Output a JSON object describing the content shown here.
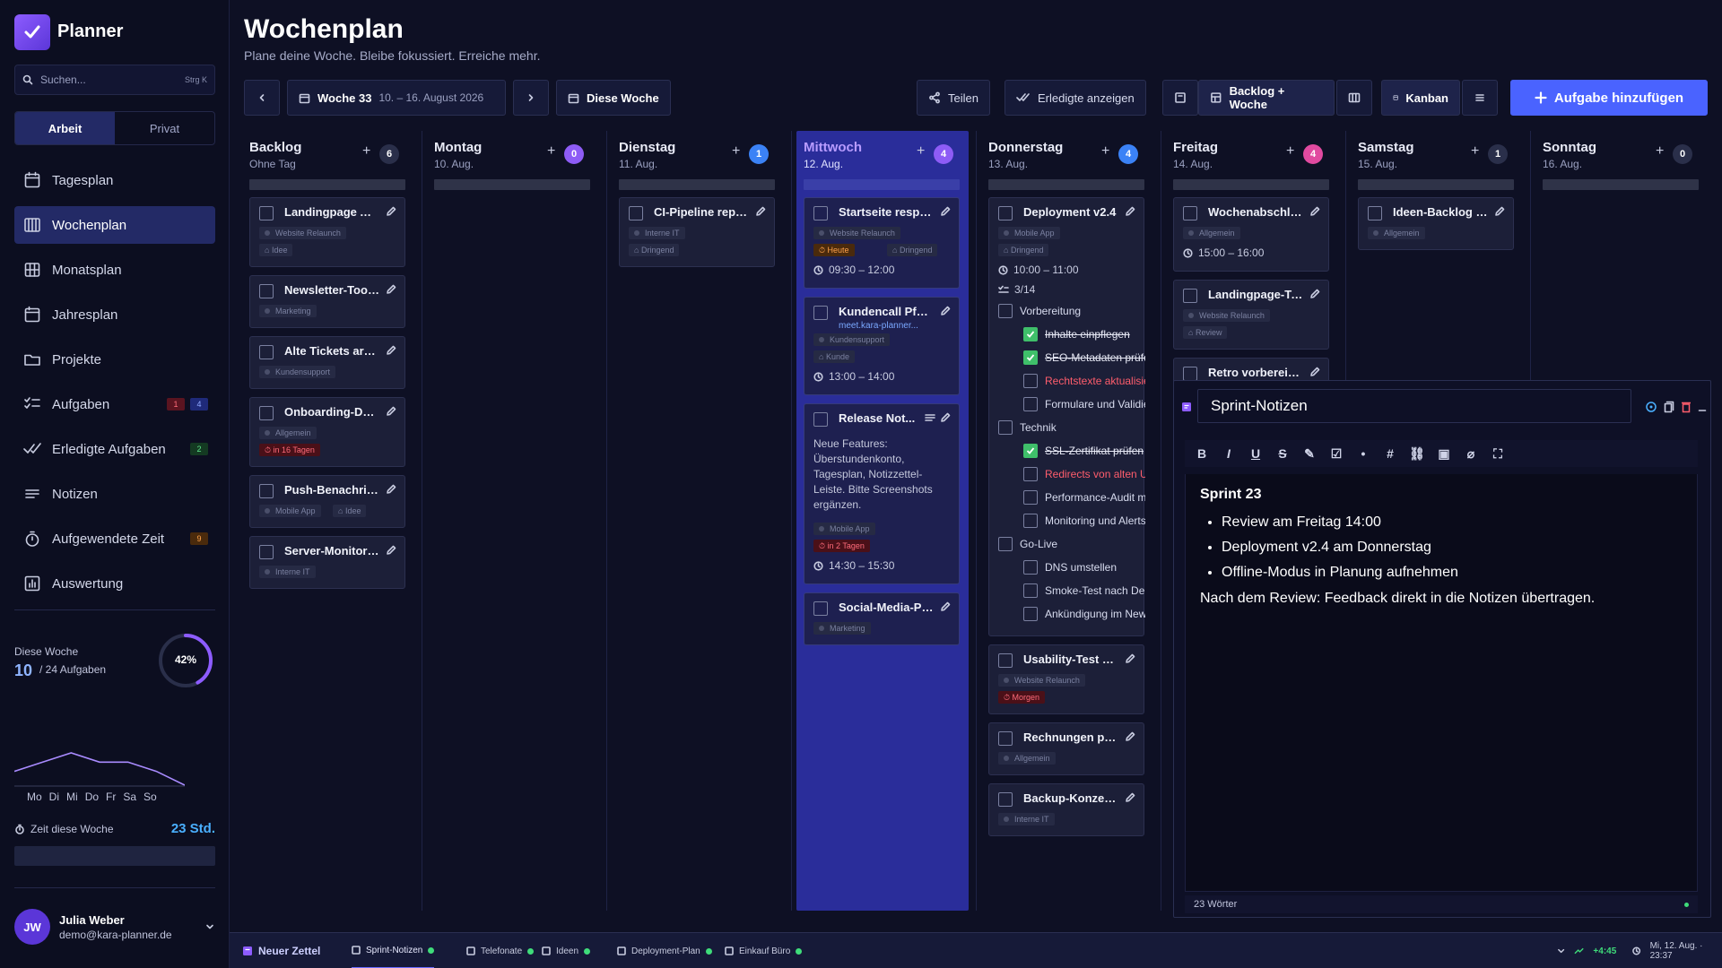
{
  "app": {
    "name": "Planner"
  },
  "search": {
    "placeholder": "Suchen...",
    "shortcut": "Strg K"
  },
  "modes": [
    "Arbeit",
    "Privat"
  ],
  "nav": [
    {
      "label": "Tagesplan",
      "icon": "calendar-day-icon"
    },
    {
      "label": "Wochenplan",
      "icon": "calendar-week-icon",
      "active": true
    },
    {
      "label": "Monatsplan",
      "icon": "calendar-grid-icon"
    },
    {
      "label": "Jahresplan",
      "icon": "calendar-year-icon"
    },
    {
      "label": "Projekte",
      "icon": "folder-icon"
    },
    {
      "label": "Aufgaben",
      "icon": "checklist-icon",
      "badges": [
        {
          "text": "1",
          "color": "red"
        },
        {
          "text": "4",
          "color": "blue"
        }
      ]
    },
    {
      "label": "Erledigte Aufgaben",
      "icon": "double-check-icon",
      "badges": [
        {
          "text": "2",
          "color": "green"
        }
      ]
    },
    {
      "label": "Notizen",
      "icon": "notes-icon"
    },
    {
      "label": "Aufgewendete Zeit",
      "icon": "stopwatch-icon",
      "badges": [
        {
          "text": "9",
          "color": "orange"
        }
      ]
    },
    {
      "label": "Auswertung",
      "icon": "chart-icon"
    }
  ],
  "week_stats": {
    "label": "Diese Woche",
    "done": "10",
    "total": "/ 24 Aufgaben",
    "percent_text": "42%",
    "progress": 0.42,
    "days": [
      "Mo",
      "Di",
      "Mi",
      "Do",
      "Fr",
      "Sa",
      "So"
    ],
    "spark": [
      3,
      5,
      7,
      5,
      5,
      3,
      0
    ],
    "time_label": "Zeit diese Woche",
    "time_value": "23 Std."
  },
  "user": {
    "initials": "JW",
    "name": "Julia Weber",
    "email": "demo@kara-planner.de"
  },
  "header": {
    "title": "Wochenplan",
    "subtitle": "Plane deine Woche. Bleibe fokussiert. Erreiche mehr."
  },
  "toolbar": {
    "week": "Woche 33",
    "range": "10. – 16. August 2026",
    "this_week": "Diese Woche",
    "share": "Teilen",
    "show_done": "Erledigte anzeigen",
    "backlog_week": "Backlog + Woche",
    "kanban": "Kanban",
    "add_task": "Aufgabe hinzufügen"
  },
  "columns": [
    {
      "name": "Backlog",
      "date": "Ohne Tag",
      "count": "6",
      "count_color": "#2a2f4a"
    },
    {
      "name": "Montag",
      "date": "10. Aug.",
      "count": "0",
      "count_color": "#8e5cf6"
    },
    {
      "name": "Dienstag",
      "date": "11. Aug.",
      "count": "1",
      "count_color": "#3b82f6"
    },
    {
      "name": "Mittwoch",
      "date": "12. Aug.",
      "count": "4",
      "count_color": "#8e5cf6"
    },
    {
      "name": "Donnerstag",
      "date": "13. Aug.",
      "count": "4",
      "count_color": "#3b82f6"
    },
    {
      "name": "Freitag",
      "date": "14. Aug.",
      "count": "4",
      "count_color": "#e14aa0"
    },
    {
      "name": "Samstag",
      "date": "15. Aug.",
      "count": "1",
      "count_color": "#2a2f4a"
    },
    {
      "name": "Sonntag",
      "date": "16. Aug.",
      "count": "0",
      "count_color": "#2a2f4a"
    }
  ],
  "cards": {
    "backlog": [
      {
        "title": "Landingpage A/...",
        "tags": [
          "Website Relaunch"
        ],
        "labels": [
          "Idee"
        ]
      },
      {
        "title": "Newsletter-Tool ...",
        "tags": [
          "Marketing"
        ]
      },
      {
        "title": "Alte Tickets arc...",
        "tags": [
          "Kundensupport"
        ]
      },
      {
        "title": "Onboarding-Dok...",
        "tags": [
          "Allgemein"
        ],
        "due": "in 16 Tagen"
      },
      {
        "title": "Push-Benachric...",
        "tags": [
          "Mobile App"
        ],
        "labels": [
          "Idee"
        ]
      },
      {
        "title": "Server-Monitori...",
        "tags": [
          "Interne IT"
        ]
      }
    ],
    "dienstag": [
      {
        "title": "CI-Pipeline repa...",
        "tags": [
          "Interne IT"
        ],
        "labels": [
          "Dringend"
        ]
      }
    ],
    "mittwoch": [
      {
        "title": "Startseite respo...",
        "tags": [
          "Website Relaunch"
        ],
        "today": "Heute",
        "labels": [
          "Dringend"
        ],
        "time": "09:30 – 12:00"
      },
      {
        "title": "Kundencall Pfalz...",
        "link": "meet.kara-planner...",
        "tags": [
          "Kundensupport"
        ],
        "labels": [
          "Kunde"
        ],
        "time": "13:00 – 14:00"
      },
      {
        "title": "Release Not...",
        "desc": "Neue Features: Überstundenkonto, Tagesplan, Notizzettel-Leiste. Bitte Screenshots ergänzen.",
        "tags": [
          "Mobile App"
        ],
        "due": "in 2 Tagen",
        "time": "14:30 – 15:30"
      },
      {
        "title": "Social-Media-Po...",
        "tags": [
          "Marketing"
        ]
      }
    ],
    "donnerstag": [
      {
        "title": "Deployment v2.4",
        "tags": [
          "Mobile App"
        ],
        "labels": [
          "Dringend"
        ],
        "time": "10:00 – 11:00",
        "progress": "3/14",
        "checklist": [
          {
            "text": "Vorbereitung",
            "level": 0
          },
          {
            "text": "Inhalte einpflegen",
            "level": 1,
            "done": true
          },
          {
            "text": "SEO-Metadaten prüfen",
            "level": 1,
            "done": true
          },
          {
            "text": "Rechtstexte aktualisieren",
            "level": 1,
            "red": true
          },
          {
            "text": "Formulare und Validierung",
            "level": 1
          },
          {
            "text": "Technik",
            "level": 0
          },
          {
            "text": "SSL-Zertifikat prüfen",
            "level": 1,
            "done": true
          },
          {
            "text": "Redirects von alten URLs",
            "level": 1,
            "red": true
          },
          {
            "text": "Performance-Audit machen",
            "level": 1
          },
          {
            "text": "Monitoring und Alerts",
            "level": 1
          },
          {
            "text": "Go-Live",
            "level": 0
          },
          {
            "text": "DNS umstellen",
            "level": 1
          },
          {
            "text": "Smoke-Test nach Deploy",
            "level": 1
          },
          {
            "text": "Ankündigung im Newsletter",
            "level": 1
          }
        ]
      },
      {
        "title": "Usability-Test d...",
        "tags": [
          "Website Relaunch"
        ],
        "due": "Morgen"
      },
      {
        "title": "Rechnungen prü...",
        "tags": [
          "Allgemein"
        ]
      },
      {
        "title": "Backup-Konzept...",
        "tags": [
          "Interne IT"
        ]
      }
    ],
    "freitag": [
      {
        "title": "Wochenabschlu...",
        "tags": [
          "Allgemein"
        ],
        "time": "15:00 – 16:00"
      },
      {
        "title": "Landingpage-Te...",
        "tags": [
          "Website Relaunch"
        ],
        "labels": [
          "Review"
        ]
      },
      {
        "title": "Retro vorbereiten"
      }
    ],
    "samstag": [
      {
        "title": "Ideen-Backlog a...",
        "tags": [
          "Allgemein"
        ]
      }
    ]
  },
  "note": {
    "title": "Sprint-Notizen",
    "heading": "Sprint 23",
    "bullets": [
      "Review am Freitag 14:00",
      "Deployment v2.4 am Donnerstag",
      "Offline-Modus in Planung aufnehmen"
    ],
    "paragraph": "Nach dem Review: Feedback direkt in die Notizen übertragen.",
    "word_count": "23 Wörter",
    "tools": [
      "B",
      "I",
      "U",
      "S",
      "highlight",
      "checklist",
      "bullet-list",
      "numbered-list",
      "link",
      "image",
      "clear-format",
      "fullscreen"
    ]
  },
  "bottombar": {
    "new_note": "Neuer Zettel",
    "notes": [
      "Sprint-Notizen",
      "Telefonate",
      "Ideen",
      "Deployment-Plan",
      "Einkauf Büro"
    ],
    "delta": "+4:45",
    "datetime": "Mi, 12. Aug. · 23:37"
  },
  "colors": {
    "accent": "#4a63ff",
    "active_column": "#2a2d9a",
    "brand": "#8d5cff"
  }
}
